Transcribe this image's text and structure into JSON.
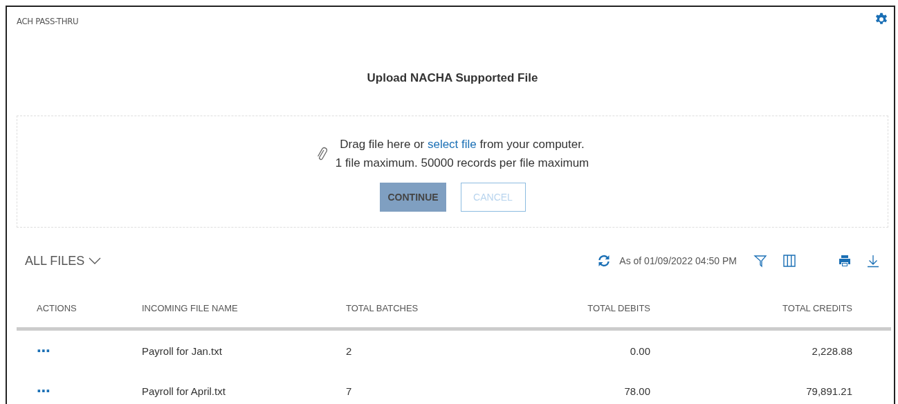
{
  "page": {
    "title": "ACH PASS-THRU"
  },
  "upload": {
    "heading": "Upload NACHA Supported File",
    "line_1": {
      "before": "Drag file here or",
      "link": "select file",
      "after": "from your computer."
    },
    "line_2": "1 file maximum. 50000 records per file maximum",
    "buttons": [
      {
        "label": "CONTINUE",
        "kind": "primary",
        "disabled": true
      },
      {
        "label": "CANCEL",
        "kind": "secondary",
        "disabled": true
      }
    ]
  },
  "toolbar": {
    "view": "ALL FILES",
    "as_of": "As of 01/09/2022 04:50 PM"
  },
  "table": {
    "columns": [
      "ACTIONS",
      "INCOMING FILE NAME",
      "TOTAL BATCHES",
      "TOTAL DEBITS",
      "TOTAL CREDITS"
    ],
    "rows": [
      {
        "cells": [
          "⋯",
          "Payroll for Jan.txt",
          "2",
          "0.00",
          "2,228.88"
        ]
      },
      {
        "cells": [
          "⋯",
          "Payroll for April.txt",
          "7",
          "78.00",
          "79,891.21"
        ]
      }
    ]
  }
}
